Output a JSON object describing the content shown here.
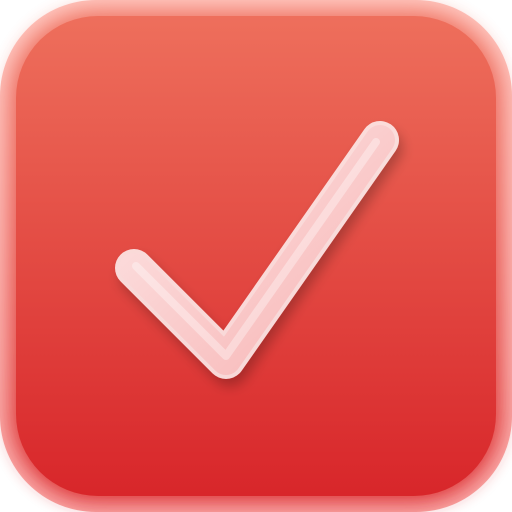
{
  "icon": {
    "name": "checkmark-app-icon",
    "glyph": "check-icon",
    "colors": {
      "tile_top": "#ee6f5c",
      "tile_bottom": "#d8262a",
      "rim_light": "#f99a92",
      "check_fill_top": "#fde6e6",
      "check_fill_bottom": "#f7b3b3",
      "check_edge": "#fff2f2"
    }
  }
}
